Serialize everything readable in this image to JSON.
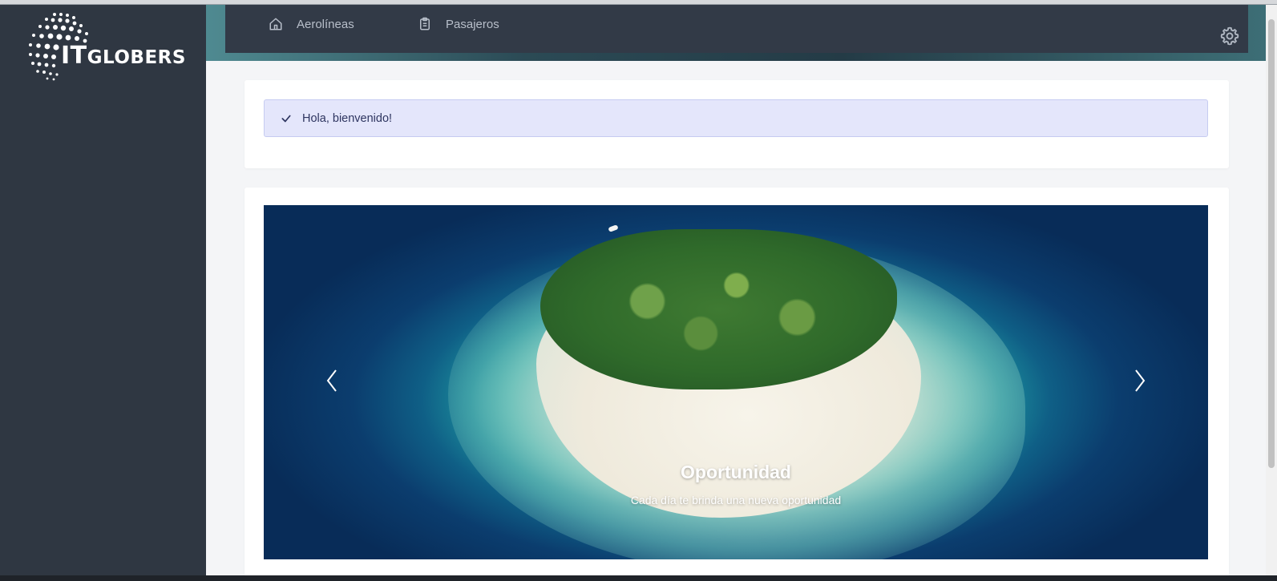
{
  "brand": {
    "logo_it": "IT",
    "logo_name": "GLOBERS"
  },
  "nav": {
    "items": [
      {
        "label": "Aerolíneas",
        "icon": "home-icon"
      },
      {
        "label": "Pasajeros",
        "icon": "clipboard-icon"
      }
    ],
    "settings_icon": "gear-icon"
  },
  "alert": {
    "icon": "check-icon",
    "message": "Hola, bienvenido!"
  },
  "carousel": {
    "slide_title": "Oportunidad",
    "slide_text": "Cada día te brinda una nueva oportunidad",
    "prev_icon": "chevron-left-icon",
    "next_icon": "chevron-right-icon"
  },
  "colors": {
    "sidebar": "#2f3742",
    "navbar": "#323a47",
    "alert_bg": "#e4e6fb",
    "alert_text": "#2e3560"
  }
}
